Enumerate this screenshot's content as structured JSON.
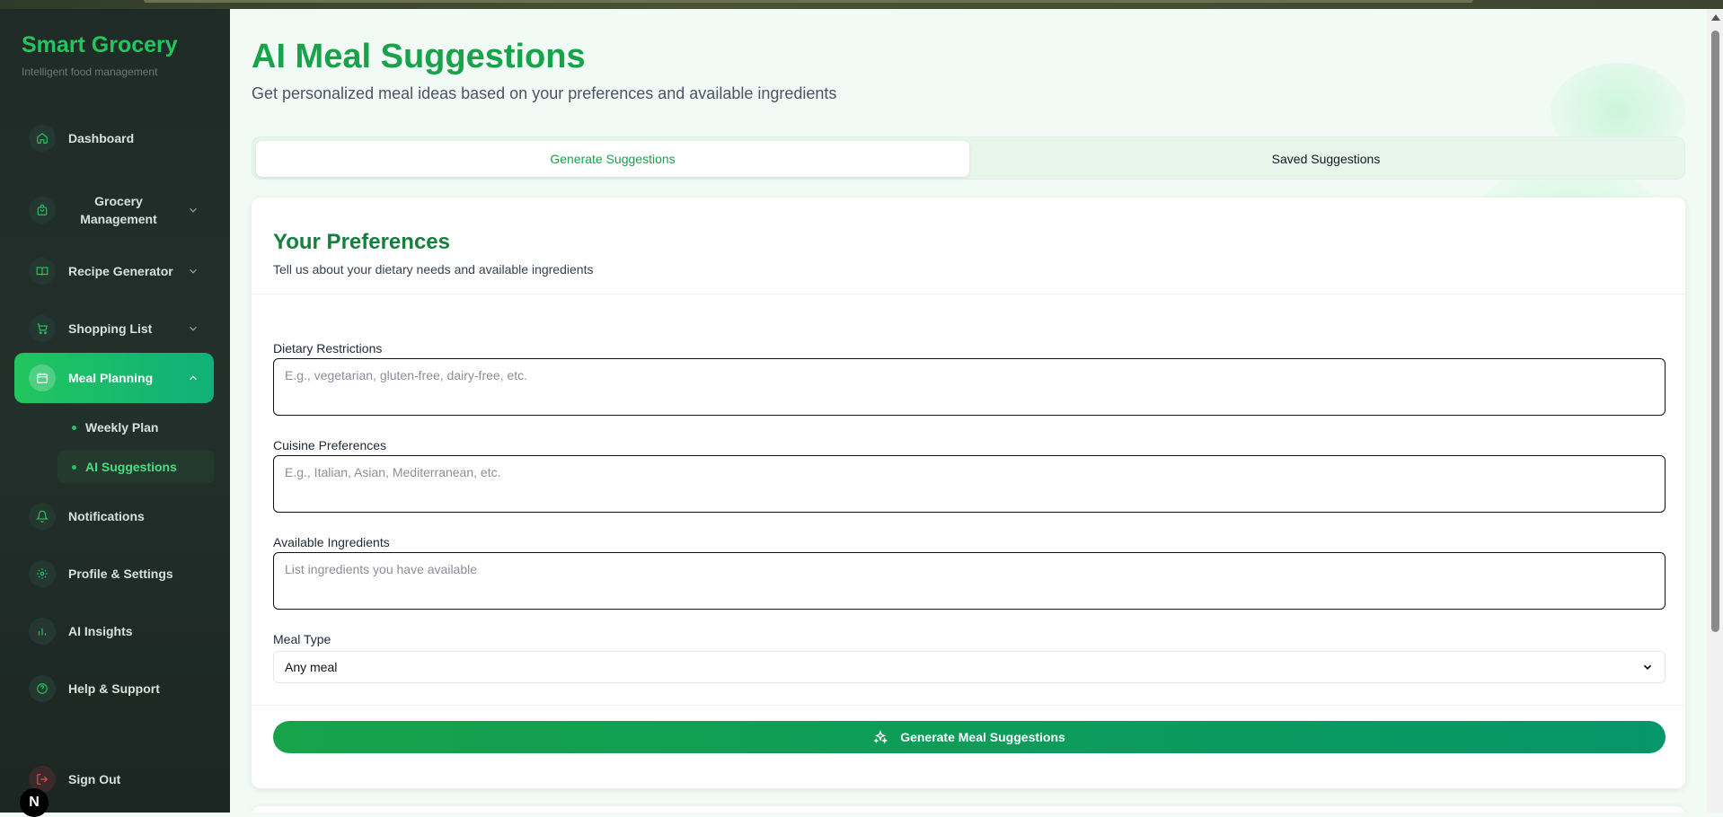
{
  "brand": {
    "title": "Smart Grocery",
    "subtitle": "Intelligent food management"
  },
  "sidebar": {
    "items": [
      {
        "label": "Dashboard",
        "icon": "home-icon"
      },
      {
        "label": "Grocery Management",
        "icon": "shopping-bag-icon"
      },
      {
        "label": "Recipe Generator",
        "icon": "book-open-icon"
      },
      {
        "label": "Shopping List",
        "icon": "cart-icon"
      },
      {
        "label": "Meal Planning",
        "icon": "calendar-icon"
      },
      {
        "label": "Notifications",
        "icon": "bell-icon"
      },
      {
        "label": "Profile & Settings",
        "icon": "gear-icon"
      },
      {
        "label": "AI Insights",
        "icon": "bar-chart-icon"
      },
      {
        "label": "Help & Support",
        "icon": "help-circle-icon"
      }
    ],
    "subitems": [
      {
        "label": "Weekly Plan"
      },
      {
        "label": "AI Suggestions"
      }
    ],
    "signout": "Sign Out",
    "badge": "N"
  },
  "page": {
    "title": "AI Meal Suggestions",
    "subtitle": "Get personalized meal ideas based on your preferences and available ingredients"
  },
  "tabs": [
    {
      "label": "Generate Suggestions",
      "active": true
    },
    {
      "label": "Saved Suggestions",
      "active": false
    }
  ],
  "form": {
    "title": "Your Preferences",
    "subtitle": "Tell us about your dietary needs and available ingredients",
    "dietary": {
      "label": "Dietary Restrictions",
      "placeholder": "E.g., vegetarian, gluten-free, dairy-free, etc.",
      "value": ""
    },
    "cuisine": {
      "label": "Cuisine Preferences",
      "placeholder": "E.g., Italian, Asian, Mediterranean, etc.",
      "value": ""
    },
    "ingredients": {
      "label": "Available Ingredients",
      "placeholder": "List ingredients you have available",
      "value": ""
    },
    "meal_type": {
      "label": "Meal Type",
      "value": "Any meal"
    },
    "submit_label": "Generate Meal Suggestions"
  },
  "colors": {
    "accent": "#22c55e",
    "brand_green": "#16a34a",
    "sidebar_bg": "#1f2b27"
  }
}
